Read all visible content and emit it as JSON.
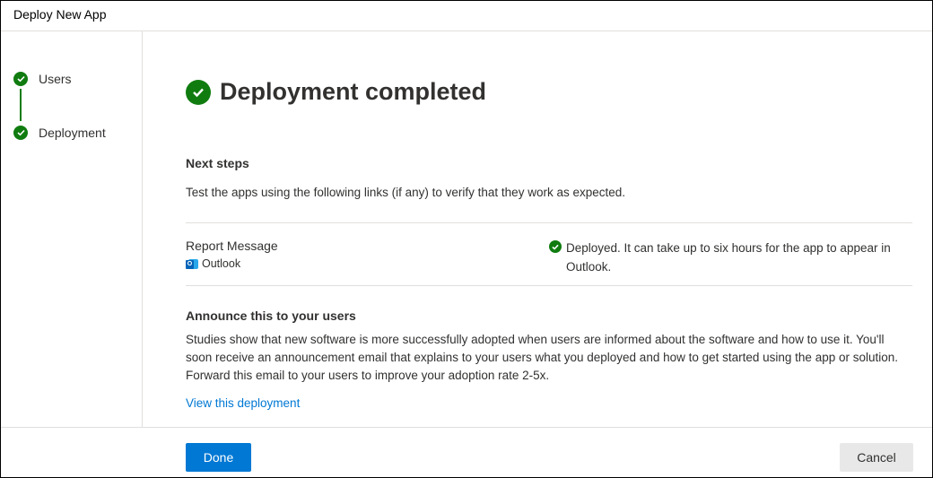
{
  "window": {
    "title": "Deploy New App"
  },
  "steps": [
    {
      "label": "Users",
      "status": "complete",
      "icon": "check-circle-icon"
    },
    {
      "label": "Deployment",
      "status": "complete",
      "icon": "check-circle-icon"
    }
  ],
  "colors": {
    "success": "#107c10",
    "primary": "#0078d4",
    "link": "#0078d4"
  },
  "main": {
    "heading": "Deployment completed",
    "next_steps": {
      "title": "Next steps",
      "description": "Test the apps using the following links (if any) to verify that they work as expected."
    },
    "deployment_row": {
      "name": "Report Message",
      "app": "Outlook",
      "app_icon": "outlook-icon",
      "status_icon": "check-circle-icon",
      "status_text": "Deployed. It can take up to six hours for the app to appear in Outlook."
    },
    "announce": {
      "title": "Announce this to your users",
      "body": "Studies show that new software is more successfully adopted when users are informed about the software and how to use it. You'll soon receive an announcement email that explains to your users what you deployed and how to get started using the app or solution. Forward this email to your users to improve your adoption rate 2-5x."
    },
    "view_link": "View this deployment"
  },
  "footer": {
    "done_label": "Done",
    "cancel_label": "Cancel"
  }
}
